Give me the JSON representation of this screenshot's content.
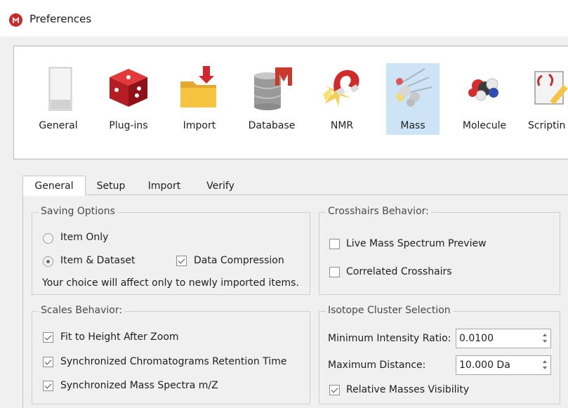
{
  "window": {
    "title": "Preferences"
  },
  "categories": [
    {
      "label": "General",
      "icon": "switch-icon"
    },
    {
      "label": "Plug-ins",
      "icon": "dice-icon"
    },
    {
      "label": "Import",
      "icon": "import-folder-icon"
    },
    {
      "label": "Database",
      "icon": "database-icon"
    },
    {
      "label": "NMR",
      "icon": "magnet-icon"
    },
    {
      "label": "Mass",
      "icon": "mass-ions-icon",
      "selected": true
    },
    {
      "label": "Molecule",
      "icon": "molecule-icon"
    },
    {
      "label": "Scriptin",
      "icon": "script-icon"
    }
  ],
  "tabs": [
    {
      "label": "General",
      "active": true
    },
    {
      "label": "Setup"
    },
    {
      "label": "Import"
    },
    {
      "label": "Verify"
    }
  ],
  "saving_options": {
    "title": "Saving Options",
    "item_only": {
      "label": "Item Only",
      "checked": false
    },
    "item_dataset": {
      "label": "Item & Dataset",
      "checked": true
    },
    "data_compression": {
      "label": "Data Compression",
      "checked": true
    },
    "note": "Your choice will affect only to newly imported  items."
  },
  "crosshairs": {
    "title": "Crosshairs Behavior:",
    "live_preview": {
      "label": "Live Mass Spectrum Preview",
      "checked": false
    },
    "correlated": {
      "label": "Correlated Crosshairs",
      "checked": false
    }
  },
  "scales": {
    "title": "Scales Behavior:",
    "fit_height": {
      "label": "Fit to Height After Zoom",
      "checked": true
    },
    "sync_chrom": {
      "label": "Synchronized Chromatograms Retention Time",
      "checked": true
    },
    "sync_mass": {
      "label": "Synchronized Mass Spectra m/Z",
      "checked": true
    }
  },
  "isotope": {
    "title": "Isotope Cluster Selection",
    "min_intensity": {
      "label": "Minimum Intensity Ratio:",
      "value": "0.0100"
    },
    "max_distance": {
      "label": "Maximum Distance:",
      "value": "10.000 Da"
    },
    "relative_masses": {
      "label": "Relative Masses Visibility",
      "checked": true
    }
  },
  "colors": {
    "selected_category": "#cde4f7",
    "brand": "#cc2a2a"
  }
}
